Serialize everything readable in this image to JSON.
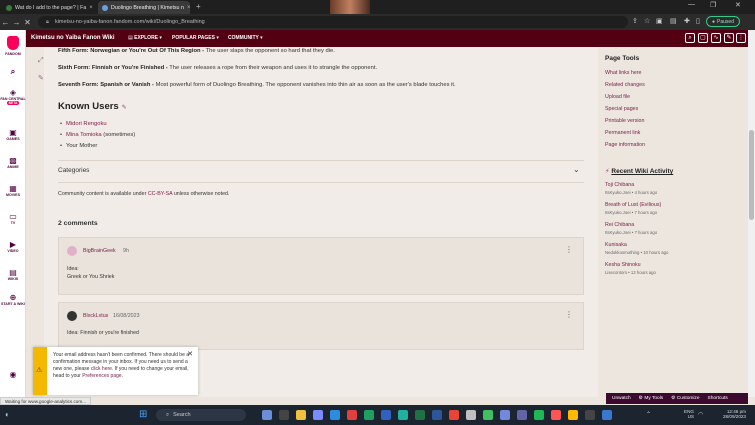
{
  "browser": {
    "tabs": [
      {
        "label": "Wat do I add to the page? | Fa",
        "fav_color": "#3a7d3a"
      },
      {
        "label": "Duolingo Breathing | Kimetsu n",
        "fav_color": "#6aa0e0"
      }
    ],
    "url": "kimetsu-no-yaiba-fanon.fandom.com/wiki/Duolingo_Breathing",
    "profile_label": "Paused"
  },
  "rail": {
    "brand": "FANDOM",
    "items": [
      {
        "label": "FAN CENTRAL",
        "badge": "BETA"
      },
      {
        "label": "GAMES"
      },
      {
        "label": "ANIME"
      },
      {
        "label": "MOVIES"
      },
      {
        "label": "TV"
      },
      {
        "label": "VIDEO"
      },
      {
        "label": "WIKIS"
      },
      {
        "label": "START A WIKI"
      }
    ]
  },
  "wiki": {
    "title": "Kimetsu no Yaiba Fanon Wiki",
    "nav": [
      "EXPLORE",
      "POPULAR PAGES",
      "COMMUNITY"
    ]
  },
  "article": {
    "forms": [
      {
        "name": "Fifth Form: Norwegian or You're Out Of This Region -",
        "desc": " The user slaps the opponent so hard that they die."
      },
      {
        "name": "Sixth Form: Finnish or You're Finished -",
        "desc": " The user releases a rope from their weapon and uses it to strangle the opponent."
      },
      {
        "name": "Seventh Form: Spanish or Vanish -",
        "desc": " Most powerful form of Duolingo Breathing. The opponent vanishes into thin air as soon as the user's blade touches it."
      }
    ],
    "known_users_heading": "Known Users",
    "known_users": [
      {
        "name": "Midori Rengoku",
        "suffix": ""
      },
      {
        "name": "Mina Tomioka",
        "suffix": " (sometimes)"
      },
      {
        "name": "Your Mother",
        "suffix": ""
      }
    ],
    "categories_label": "Categories",
    "license_prefix": "Community content is available under ",
    "license_link": "CC-BY-SA",
    "license_suffix": " unless otherwise noted."
  },
  "comments": {
    "count_label": "2 comments",
    "items": [
      {
        "user": "BigBrainGeek",
        "time": "9h",
        "lines": [
          "Idea:",
          "Greek or You Shriek"
        ]
      },
      {
        "user": "BlxckLxtus",
        "time": "16/08/2023",
        "lines": [
          "Idea: Finnish or you're finished"
        ]
      }
    ]
  },
  "sidebar": {
    "page_tools_heading": "Page Tools",
    "page_tools": [
      "What links here",
      "Related changes",
      "Upload file",
      "Special pages",
      "Printable version",
      "Permanent link",
      "Page information"
    ],
    "recent_heading": "Recent Wiki Activity",
    "recent": [
      {
        "title": "Toji Chibana",
        "meta": "ItsKyuko.Joei • 4 hours ago"
      },
      {
        "title": "Breath of Lust (Evilious)",
        "meta": "ItsKyuko.Joei • 7 hours ago"
      },
      {
        "title": "Rei Chibana",
        "meta": "ItsKyuko.Joei • 7 hours ago"
      },
      {
        "title": "Kunisaka",
        "meta": "Nedokkosmothing • 10 hours ago"
      },
      {
        "title": "Kesha Shinoku",
        "meta": "Lisecontors • 13 hours ago"
      }
    ]
  },
  "notice": {
    "text_1": "Your email address hasn't been confirmed. There should be a confirmation message in your inbox. If you need us to send a new one, please ",
    "link_1": "click here",
    "text_2": ". If you need to change your email, head to your ",
    "link_2": "Preferences page",
    "text_3": "."
  },
  "status_text": "Waiting for www.google-analytics.com...",
  "fandom_toolbar": [
    "Unwatch",
    "My Tools",
    "Customize",
    "Shortcuts"
  ],
  "taskbar": {
    "search_placeholder": "Search",
    "lang": "ENG",
    "region": "US",
    "time": "12:46 pm",
    "date": "28/09/2023"
  }
}
